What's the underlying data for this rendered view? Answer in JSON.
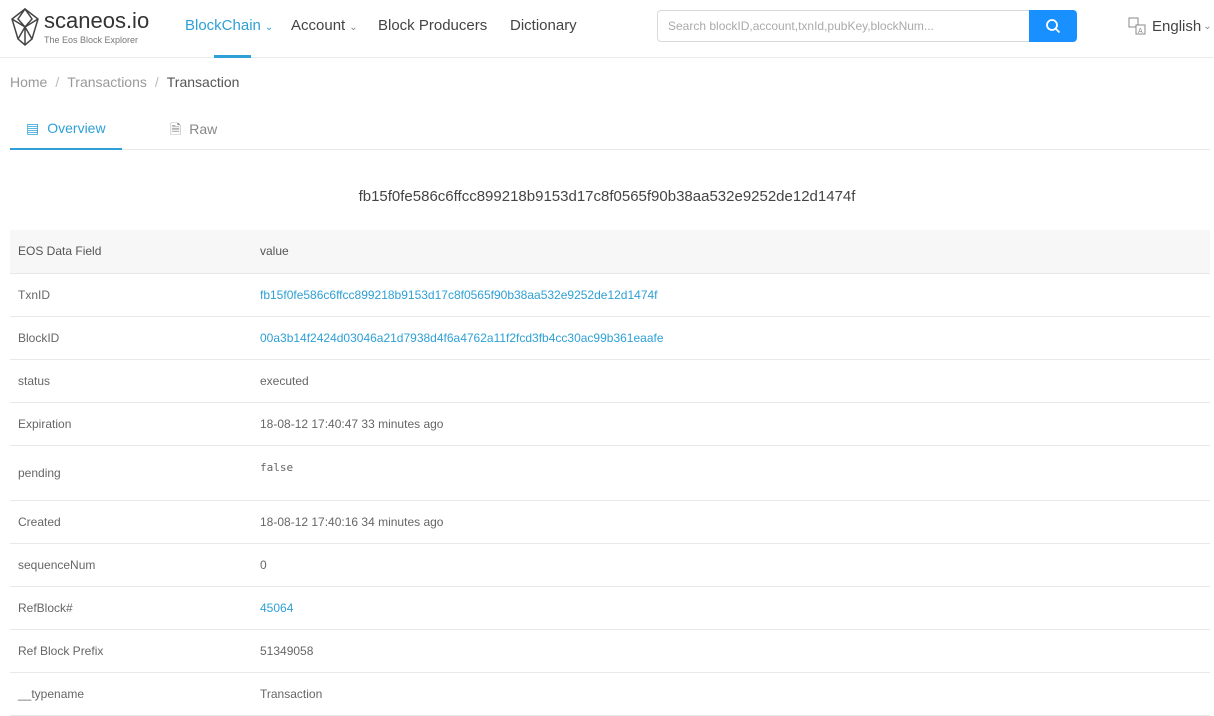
{
  "header": {
    "brand": "scaneos.io",
    "tagline": "The Eos Block Explorer",
    "nav": [
      {
        "label": "BlockChain"
      },
      {
        "label": "Account"
      },
      {
        "label": "Block Producers"
      },
      {
        "label": "Dictionary"
      }
    ],
    "search_placeholder": "Search blockID,account,txnId,pubKey,blockNum...",
    "language": "English"
  },
  "breadcrumb": [
    "Home",
    "Transactions",
    "Transaction"
  ],
  "tabs": [
    "Overview",
    "Raw"
  ],
  "txn_hash": "fb15f0fe586c6ffcc899218b9153d17c8f0565f90b38aa532e9252de12d1474f",
  "table": {
    "headers": [
      "EOS Data Field",
      "value"
    ],
    "rows": [
      {
        "field": "TxnID",
        "value": "fb15f0fe586c6ffcc899218b9153d17c8f0565f90b38aa532e9252de12d1474f"
      },
      {
        "field": "BlockID",
        "value": "00a3b14f2424d03046a21d7938d4f6a4762a11f2fcd3fb4cc30ac99b361eaafe"
      },
      {
        "field": "status",
        "value": "executed"
      },
      {
        "field": "Expiration",
        "value": "18-08-12 17:40:47 33 minutes ago"
      },
      {
        "field": "pending",
        "value": "false"
      },
      {
        "field": "Created",
        "value": "18-08-12 17:40:16 34 minutes ago"
      },
      {
        "field": "sequenceNum",
        "value": "0"
      },
      {
        "field": "RefBlock#",
        "value": "45064"
      },
      {
        "field": "Ref Block Prefix",
        "value": "51349058"
      },
      {
        "field": "__typename",
        "value": "Transaction"
      }
    ]
  }
}
